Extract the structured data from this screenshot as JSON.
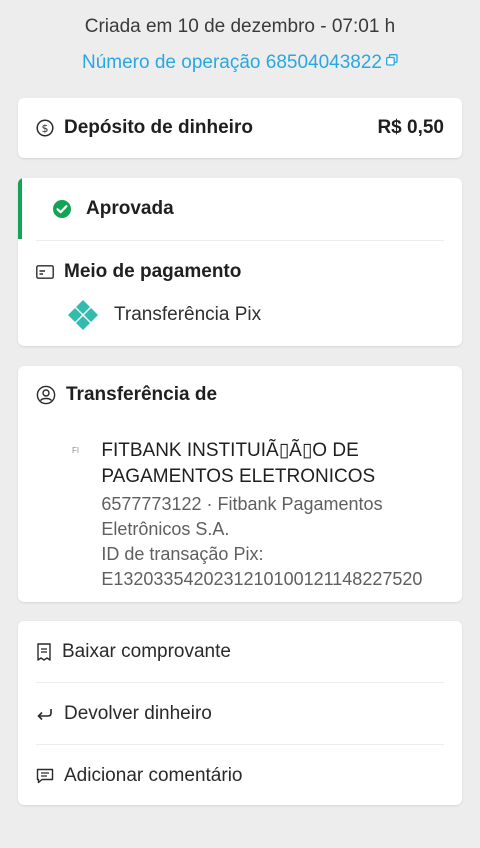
{
  "header": {
    "created": "Criada em 10 de dezembro - 07:01 h",
    "operation": "Número de operação 68504043822"
  },
  "deposit": {
    "label": "Depósito de dinheiro",
    "amount": "R$ 0,50",
    "icon": "dollar-circle-icon"
  },
  "status": {
    "label": "Aprovada",
    "color": "#12a454",
    "payment_method_title": "Meio de pagamento",
    "payment_method": "Transferência Pix",
    "pix_color": "#32bcad"
  },
  "transfer": {
    "title": "Transferência de",
    "bank_abbr": "FI",
    "bank_name_line1": "FITBANK INSTITUIÃ▯Ã▯O DE",
    "bank_name_line2": "PAGAMENTOS ELETRONICOS",
    "account_line1": "6577773122 · Fitbank Pagamentos",
    "account_line2": "Eletrônicos S.A.",
    "txid_label": "ID de transação Pix:",
    "txid": "E13203354202312101001211482275​20"
  },
  "actions": [
    {
      "label": "Baixar comprovante",
      "icon": "receipt-icon"
    },
    {
      "label": "Devolver dinheiro",
      "icon": "return-arrow-icon"
    },
    {
      "label": "Adicionar comentário",
      "icon": "comment-icon"
    }
  ],
  "colors": {
    "link": "#2aa7e0",
    "background": "#ededed"
  }
}
